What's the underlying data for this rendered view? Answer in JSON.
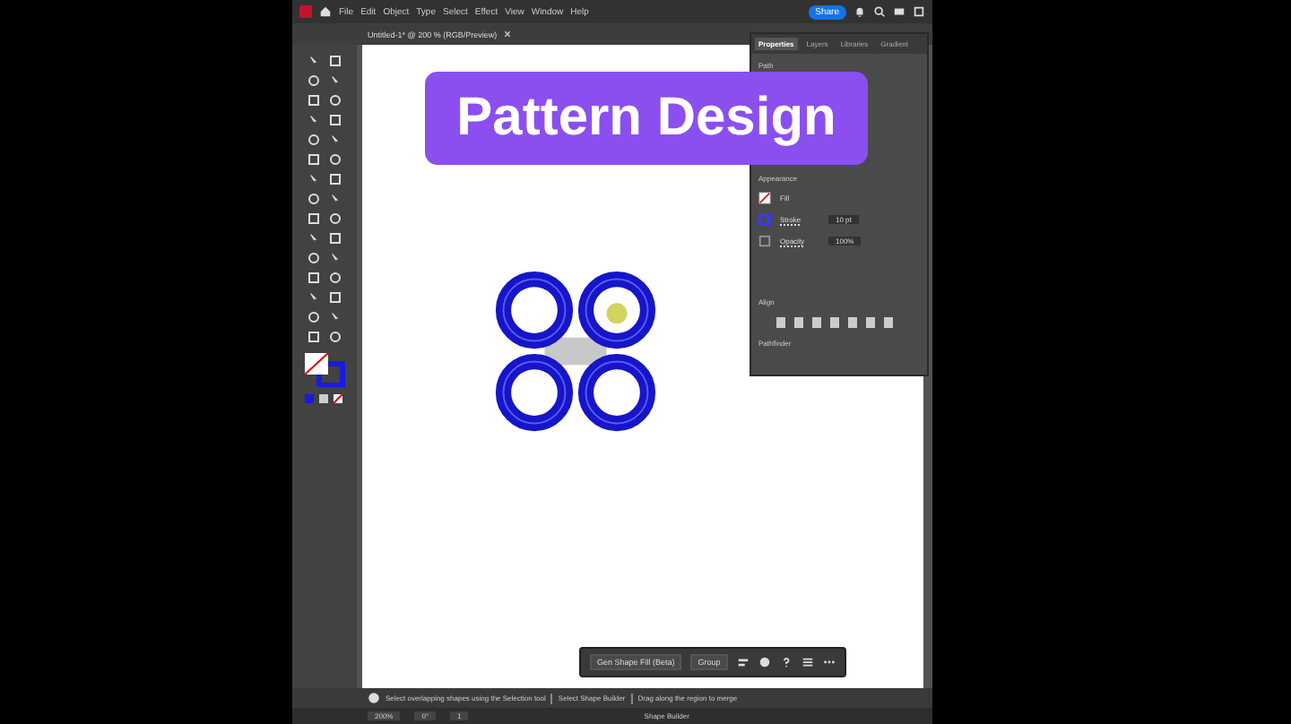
{
  "menu_bar": {
    "items": [
      "File",
      "Edit",
      "Object",
      "Type",
      "Select",
      "Effect",
      "View",
      "Window",
      "Help"
    ],
    "share_button": "Share"
  },
  "document_tab": {
    "title": "Untitled-1* @ 200 % (RGB/Preview)"
  },
  "panel": {
    "tabs": [
      {
        "label": "Properties",
        "selected": true
      },
      {
        "label": "Layers",
        "selected": false
      },
      {
        "label": "Libraries",
        "selected": false
      },
      {
        "label": "Gradient",
        "selected": false
      }
    ],
    "section_title": "Path",
    "appearance_title": "Appearance",
    "fill_label": "Fill",
    "stroke_label": "Stroke",
    "stroke_value": "10 pt",
    "opacity_label": "Opacity",
    "opacity_value": "100%",
    "align_title": "Align",
    "pathfinder_title": "Pathfinder"
  },
  "overlay_title": "Pattern Design",
  "context_bar": {
    "buttons": [
      "Gen Shape Fill (Beta)",
      "Group"
    ]
  },
  "status_hints": [
    "Select overlapping shapes using the Selection tool",
    "Select Shape Builder",
    "Drag along the region to merge"
  ],
  "bottom_bar": {
    "zoom": "200%",
    "rotation": "0°",
    "artboard": "1",
    "tool": "Shape Builder"
  }
}
